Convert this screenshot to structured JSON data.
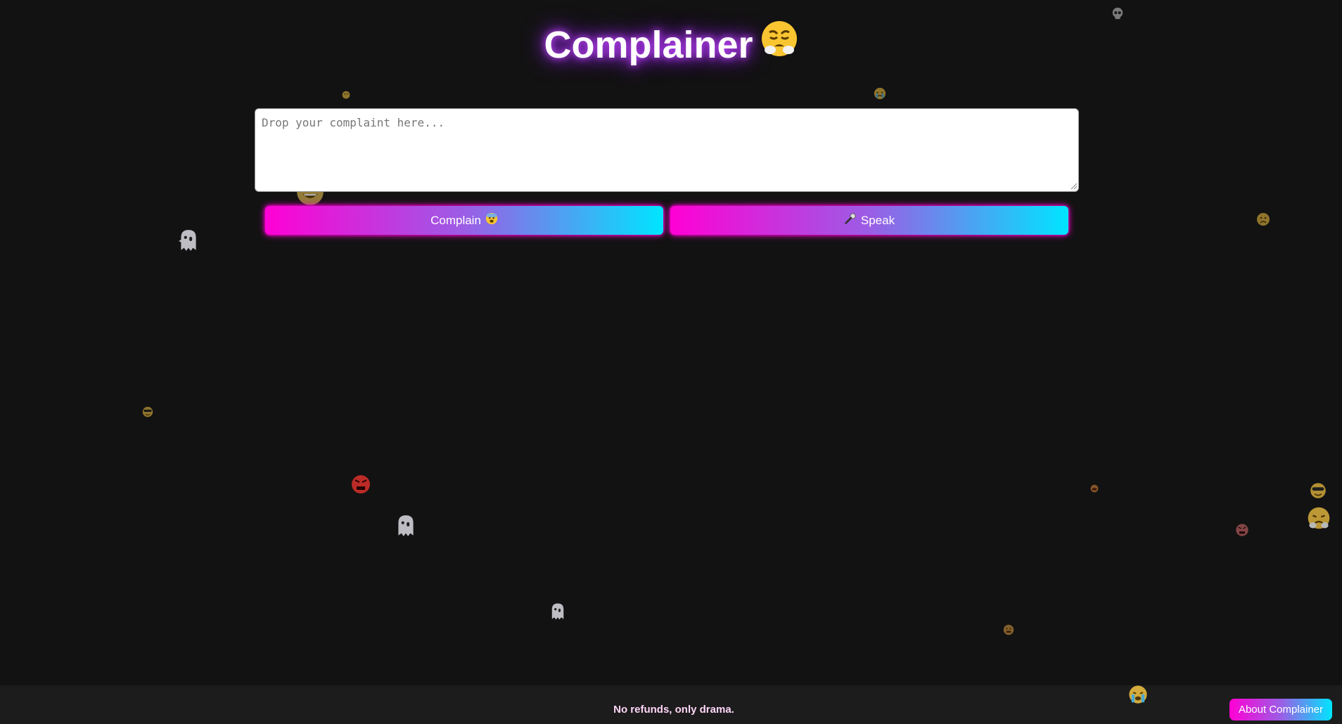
{
  "app": {
    "title": "Complainer"
  },
  "complaint": {
    "value": "",
    "placeholder": "Drop your complaint here..."
  },
  "actions": {
    "complain_label": "Complain",
    "speak_label": "Speak"
  },
  "footer": {
    "tagline": "No refunds, only drama.",
    "about_label": "About Complainer"
  },
  "colors": {
    "background": "#121212",
    "gradient_start": "#ff00d4",
    "gradient_mid": "#9b5de5",
    "gradient_end": "#00e5ff",
    "title_glow": "#a020f0"
  },
  "icons": {
    "title_icon": "steam-face-icon",
    "complain_icon": "fearful-face-icon",
    "speak_icon": "microphone-icon",
    "floaters": [
      "skull-icon",
      "tiny-face-icon",
      "ghost-icon",
      "angry-face-icon",
      "grin-face-icon",
      "crying-face-icon",
      "sunglasses-face-icon",
      "sad-face-icon"
    ]
  }
}
